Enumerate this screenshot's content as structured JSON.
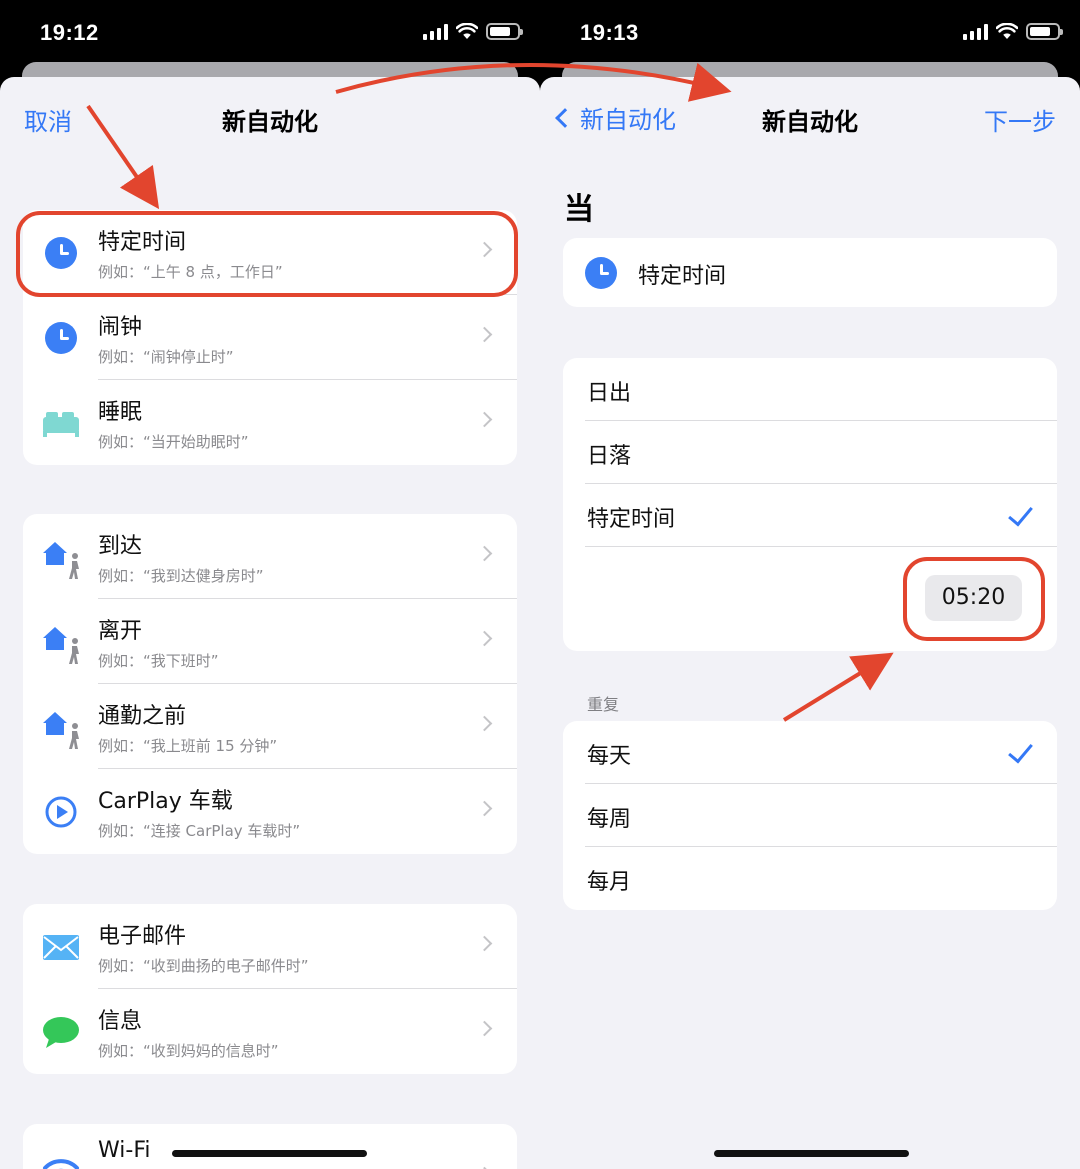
{
  "colors": {
    "accent": "#3478f6",
    "annotation": "#e2452e",
    "icon_blue": "#3b7ff5",
    "message_green": "#34c759"
  },
  "left": {
    "status": {
      "time": "19:12"
    },
    "nav": {
      "cancel": "取消",
      "title": "新自动化"
    },
    "groups": [
      [
        {
          "icon": "clock-icon",
          "title": "特定时间",
          "sub": "例如：“上午 8 点，工作日”"
        },
        {
          "icon": "alarm-clock-icon",
          "title": "闹钟",
          "sub": "例如：“闹钟停止时”"
        },
        {
          "icon": "bed-icon",
          "title": "睡眠",
          "sub": "例如：“当开始助眠时”"
        }
      ],
      [
        {
          "icon": "home-person-icon",
          "title": "到达",
          "sub": "例如：“我到达健身房时”"
        },
        {
          "icon": "home-person-icon",
          "title": "离开",
          "sub": "例如：“我下班时”"
        },
        {
          "icon": "home-person-icon",
          "title": "通勤之前",
          "sub": "例如：“我上班前 15 分钟”"
        },
        {
          "icon": "carplay-icon",
          "title": "CarPlay 车载",
          "sub": "例如：“连接 CarPlay 车载时”"
        }
      ],
      [
        {
          "icon": "mail-icon",
          "title": "电子邮件",
          "sub": "例如：“收到曲扬的电子邮件时”"
        },
        {
          "icon": "message-icon",
          "title": "信息",
          "sub": "例如：“收到妈妈的信息时”"
        }
      ],
      [
        {
          "icon": "wifi-icon",
          "title": "Wi-Fi",
          "sub": ""
        }
      ]
    ]
  },
  "right": {
    "status": {
      "time": "19:13"
    },
    "nav": {
      "back": "新自动化",
      "title": "新自动化",
      "next": "下一步"
    },
    "when_header": "当",
    "selected_trigger": {
      "icon": "clock-icon",
      "title": "特定时间"
    },
    "time_options": [
      {
        "label": "日出",
        "checked": false
      },
      {
        "label": "日落",
        "checked": false
      },
      {
        "label": "特定时间",
        "checked": true
      }
    ],
    "time_value": "05:20",
    "repeat_label": "重复",
    "repeat_options": [
      {
        "label": "每天",
        "checked": true
      },
      {
        "label": "每周",
        "checked": false
      },
      {
        "label": "每月",
        "checked": false
      }
    ]
  }
}
